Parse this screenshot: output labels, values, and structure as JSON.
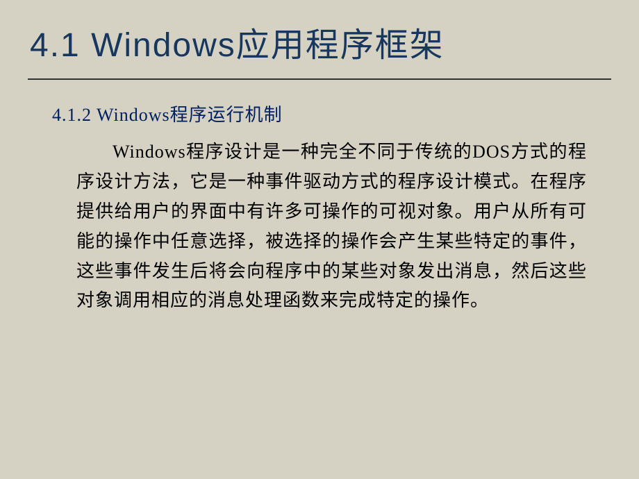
{
  "title": "4.1  Windows应用程序框架",
  "subtitle": "4.1.2  Windows程序运行机制",
  "body": "Windows程序设计是一种完全不同于传统的DOS方式的程序设计方法，它是一种事件驱动方式的程序设计模式。在程序提供给用户的界面中有许多可操作的可视对象。用户从所有可能的操作中任意选择，被选择的操作会产生某些特定的事件，这些事件发生后将会向程序中的某些对象发出消息，然后这些对象调用相应的消息处理函数来完成特定的操作。"
}
